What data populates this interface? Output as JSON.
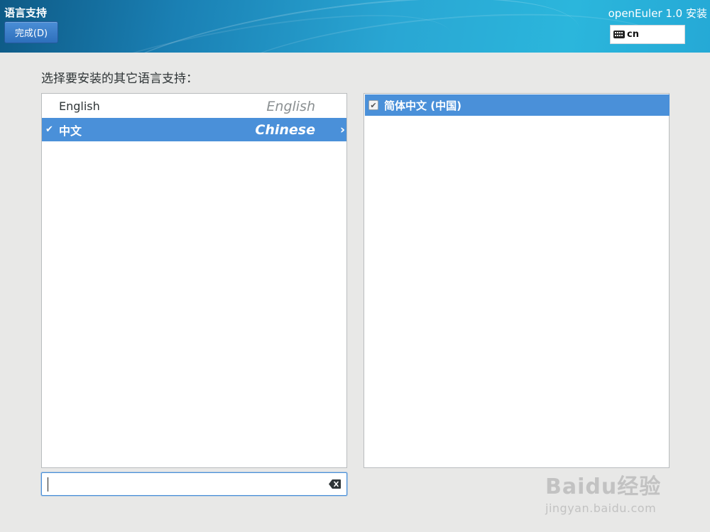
{
  "header": {
    "spoke_title": "语言支持",
    "done_button": "完成(D)",
    "product_title": "openEuler 1.0 安装",
    "keyboard_layout": "cn"
  },
  "instruction": "选择要安装的其它语言支持：",
  "languages": [
    {
      "native": "English",
      "english": "English",
      "selected": false
    },
    {
      "native": "中文",
      "english": "Chinese",
      "selected": true
    }
  ],
  "locales": [
    {
      "label": "简体中文 (中国)",
      "checked": true
    }
  ],
  "search": {
    "value": "",
    "placeholder": ""
  },
  "watermark": {
    "brand": "Baidu经验",
    "url": "jingyan.baidu.com"
  },
  "colors": {
    "selection": "#4a90d9",
    "background": "#e8e8e7",
    "header_start": "#0e5a86",
    "header_end": "#2bb6dc"
  }
}
